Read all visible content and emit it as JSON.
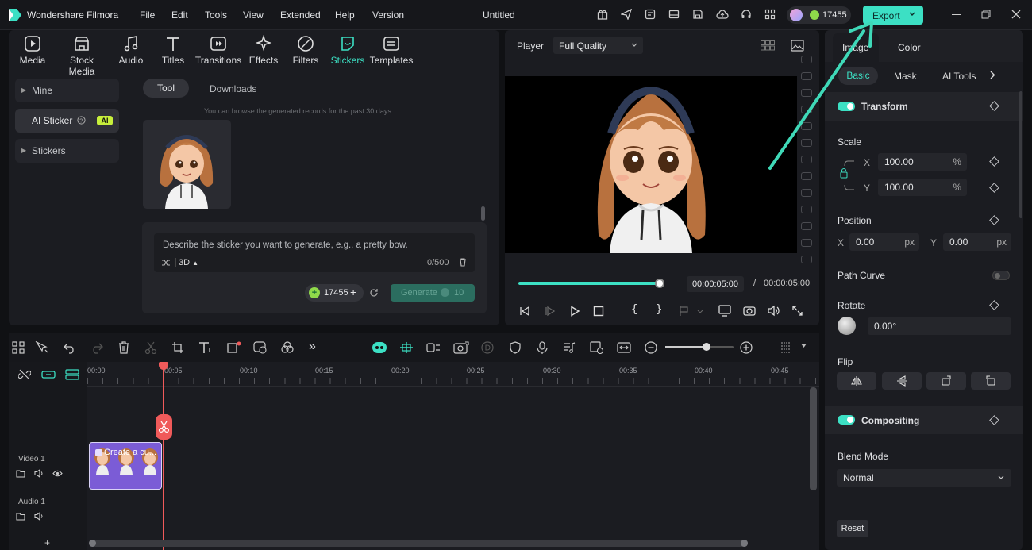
{
  "app": {
    "name": "Wondershare Filmora",
    "project_title": "Untitled",
    "credits": "17455",
    "export_label": "Export"
  },
  "menu": [
    "File",
    "Edit",
    "Tools",
    "View",
    "Extended",
    "Help",
    "Version"
  ],
  "nav": [
    "Media",
    "Stock Media",
    "Audio",
    "Titles",
    "Transitions",
    "Effects",
    "Filters",
    "Stickers",
    "Templates"
  ],
  "sidebar": {
    "mine": "Mine",
    "ai_sticker": "AI Sticker",
    "ai_badge": "AI",
    "stickers": "Stickers"
  },
  "sticker_panel": {
    "tab_tool": "Tool",
    "tab_downloads": "Downloads",
    "notice": "You can browse the generated records for the past 30 days.",
    "prompt_placeholder": "Describe the sticker you want to generate, e.g., a pretty bow.",
    "style": "3D",
    "char_count": "0/500",
    "credits": "17455",
    "generate_label": "Generate",
    "generate_cost": "10"
  },
  "player": {
    "label": "Player",
    "quality": "Full Quality",
    "current_time": "00:00:05:00",
    "separator": "/",
    "total_time": "00:00:05:00",
    "progress": 0.98
  },
  "timeline": {
    "ticks": [
      "00:00",
      "00:05",
      "00:10",
      "00:15",
      "00:20",
      "00:25",
      "00:30",
      "00:35",
      "00:40",
      "00:45"
    ],
    "video_track": "Video 1",
    "audio_track": "Audio 1",
    "clip_label": "Create a cu...",
    "zoom_level": 0.6
  },
  "inspector": {
    "tab_image": "Image",
    "tab_color": "Color",
    "subtabs": [
      "Basic",
      "Mask",
      "AI Tools"
    ],
    "transform": "Transform",
    "scale": "Scale",
    "scale_x": "100.00",
    "scale_y": "100.00",
    "percent": "%",
    "axis_x": "X",
    "axis_y": "Y",
    "position": "Position",
    "pos_x": "0.00",
    "pos_y": "0.00",
    "px": "px",
    "path_curve": "Path Curve",
    "rotate": "Rotate",
    "rotate_value": "0.00°",
    "flip": "Flip",
    "compositing": "Compositing",
    "blend_mode": "Blend Mode",
    "blend_value": "Normal",
    "reset": "Reset"
  },
  "colors": {
    "accent": "#3ce0c4",
    "clip": "#7b5cd6",
    "playhead": "#f05a5a"
  }
}
